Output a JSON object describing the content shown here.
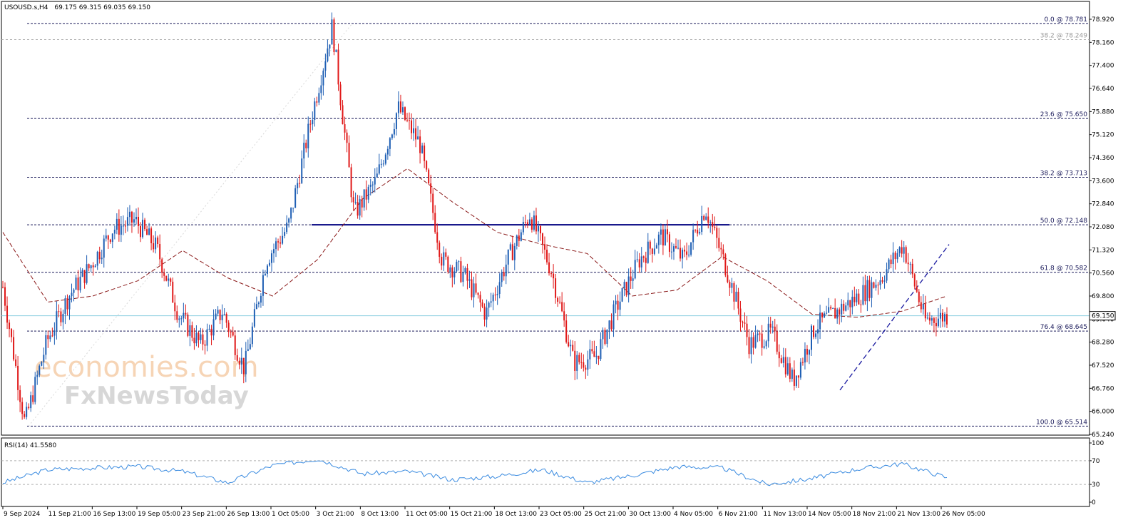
{
  "header": {
    "symbol": "USOUSD.s,H4",
    "ohlc": "69.175 69.315 69.035 69.150"
  },
  "watermark": {
    "line1": "economies.com",
    "line2": "FxNewsToday"
  },
  "rsi_panel": {
    "label": "RSI(14) 41.5580",
    "levels": [
      "100",
      "70",
      "30",
      "0"
    ]
  },
  "price_axis_ticks": [
    "78.920",
    "78.160",
    "77.400",
    "76.640",
    "75.880",
    "75.120",
    "74.360",
    "73.600",
    "72.840",
    "72.080",
    "71.320",
    "70.560",
    "69.800",
    "69.040",
    "68.280",
    "67.520",
    "66.760",
    "66.000",
    "65.240"
  ],
  "current_price": "69.150",
  "time_axis_labels": [
    "9 Sep 2024",
    "11 Sep 21:00",
    "16 Sep 13:00",
    "19 Sep 05:00",
    "23 Sep 21:00",
    "26 Sep 13:00",
    "1 Oct 05:00",
    "3 Oct 21:00",
    "8 Oct 13:00",
    "11 Oct 05:00",
    "15 Oct 21:00",
    "18 Oct 13:00",
    "23 Oct 05:00",
    "25 Oct 21:00",
    "30 Oct 13:00",
    "4 Nov 05:00",
    "6 Nov 21:00",
    "11 Nov 13:00",
    "14 Nov 05:00",
    "18 Nov 21:00",
    "21 Nov 13:00",
    "26 Nov 05:00"
  ],
  "fib_levels": [
    {
      "label": "0.0 @ 78.781",
      "value": 78.781
    },
    {
      "label": "38.2 @ 78.249",
      "value": 78.249
    },
    {
      "label": "23.6 @ 75.650",
      "value": 75.65
    },
    {
      "label": "38.2 @ 73.713",
      "value": 73.713
    },
    {
      "label": "50.0 @ 72.148",
      "value": 72.148
    },
    {
      "label": "61.8 @ 70.582",
      "value": 70.582
    },
    {
      "label": "76.4 @ 68.645",
      "value": 68.645
    },
    {
      "label": "100.0 @ 65.514",
      "value": 65.514
    }
  ],
  "colors": {
    "bull_candle": "#1f5fb4",
    "bear_candle": "#e01818",
    "fib_line": "#1a1a5a",
    "ma_line": "#8b1a1a",
    "rsi_line": "#3a8be0",
    "current_price_line": "#8ecfe0",
    "support_line": "#000080"
  },
  "chart_data": {
    "type": "candlestick",
    "y_axis_range": [
      65.24,
      78.92
    ],
    "rsi_range": [
      0,
      100
    ],
    "rsi_last": 41.558,
    "horizontal_support": 72.148,
    "price_path": [
      {
        "t": "9 Sep 2024",
        "price": 70.1
      },
      {
        "t": "10 Sep",
        "price": 65.6
      },
      {
        "t": "11 Sep 21:00",
        "price": 68.3
      },
      {
        "t": "14 Sep",
        "price": 69.8
      },
      {
        "t": "16 Sep 13:00",
        "price": 70.8
      },
      {
        "t": "19 Sep 05:00",
        "price": 72.0
      },
      {
        "t": "21 Sep",
        "price": 72.3
      },
      {
        "t": "23 Sep 21:00",
        "price": 71.4
      },
      {
        "t": "25 Sep",
        "price": 69.2
      },
      {
        "t": "26 Sep 13:00",
        "price": 68.2
      },
      {
        "t": "29 Sep",
        "price": 69.3
      },
      {
        "t": "30 Sep",
        "price": 67.4
      },
      {
        "t": "1 Oct 05:00",
        "price": 71.0
      },
      {
        "t": "2 Oct",
        "price": 72.1
      },
      {
        "t": "3 Oct 21:00",
        "price": 75.5
      },
      {
        "t": "7 Oct",
        "price": 78.7
      },
      {
        "t": "8 Oct 13:00",
        "price": 72.5
      },
      {
        "t": "9 Oct",
        "price": 73.6
      },
      {
        "t": "10 Oct",
        "price": 76.0
      },
      {
        "t": "11 Oct 05:00",
        "price": 74.8
      },
      {
        "t": "14 Oct",
        "price": 71.0
      },
      {
        "t": "15 Oct 21:00",
        "price": 70.5
      },
      {
        "t": "18 Oct 13:00",
        "price": 69.2
      },
      {
        "t": "21 Oct",
        "price": 71.0
      },
      {
        "t": "23 Oct 05:00",
        "price": 72.5
      },
      {
        "t": "24 Oct",
        "price": 70.6
      },
      {
        "t": "25 Oct 21:00",
        "price": 67.6
      },
      {
        "t": "28 Oct",
        "price": 67.8
      },
      {
        "t": "30 Oct 13:00",
        "price": 69.5
      },
      {
        "t": "1 Nov",
        "price": 71.0
      },
      {
        "t": "4 Nov 05:00",
        "price": 71.8
      },
      {
        "t": "5 Nov",
        "price": 71.0
      },
      {
        "t": "6 Nov 21:00",
        "price": 72.7
      },
      {
        "t": "8 Nov",
        "price": 70.6
      },
      {
        "t": "11 Nov 13:00",
        "price": 68.2
      },
      {
        "t": "13 Nov",
        "price": 68.6
      },
      {
        "t": "14 Nov 05:00",
        "price": 67.0
      },
      {
        "t": "15 Nov",
        "price": 68.8
      },
      {
        "t": "18 Nov 21:00",
        "price": 69.3
      },
      {
        "t": "20 Nov",
        "price": 69.8
      },
      {
        "t": "21 Nov 13:00",
        "price": 70.4
      },
      {
        "t": "22 Nov",
        "price": 71.5
      },
      {
        "t": "25 Nov",
        "price": 69.0
      },
      {
        "t": "26 Nov 05:00",
        "price": 69.15
      }
    ],
    "moving_average_path": [
      {
        "t": "9 Sep 2024",
        "price": 71.9
      },
      {
        "t": "11 Sep 21:00",
        "price": 69.6
      },
      {
        "t": "16 Sep 13:00",
        "price": 69.8
      },
      {
        "t": "19 Sep 05:00",
        "price": 70.3
      },
      {
        "t": "23 Sep 21:00",
        "price": 71.3
      },
      {
        "t": "26 Sep 13:00",
        "price": 70.4
      },
      {
        "t": "1 Oct 05:00",
        "price": 69.8
      },
      {
        "t": "3 Oct 21:00",
        "price": 71.0
      },
      {
        "t": "8 Oct 13:00",
        "price": 73.0
      },
      {
        "t": "11 Oct 05:00",
        "price": 74.0
      },
      {
        "t": "15 Oct 21:00",
        "price": 72.9
      },
      {
        "t": "18 Oct 13:00",
        "price": 71.9
      },
      {
        "t": "23 Oct 05:00",
        "price": 71.5
      },
      {
        "t": "25 Oct 21:00",
        "price": 71.2
      },
      {
        "t": "30 Oct 13:00",
        "price": 69.8
      },
      {
        "t": "4 Nov 05:00",
        "price": 70.0
      },
      {
        "t": "6 Nov 21:00",
        "price": 71.1
      },
      {
        "t": "11 Nov 13:00",
        "price": 70.3
      },
      {
        "t": "14 Nov 05:00",
        "price": 69.2
      },
      {
        "t": "18 Nov 21:00",
        "price": 69.1
      },
      {
        "t": "21 Nov 13:00",
        "price": 69.3
      },
      {
        "t": "26 Nov 05:00",
        "price": 69.8
      }
    ],
    "rsi_path": [
      {
        "t": "9 Sep 2024",
        "rsi": 33
      },
      {
        "t": "11 Sep 21:00",
        "rsi": 55
      },
      {
        "t": "16 Sep 13:00",
        "rsi": 58
      },
      {
        "t": "19 Sep 05:00",
        "rsi": 60
      },
      {
        "t": "23 Sep 21:00",
        "rsi": 52
      },
      {
        "t": "26 Sep 13:00",
        "rsi": 33
      },
      {
        "t": "1 Oct 05:00",
        "rsi": 62
      },
      {
        "t": "3 Oct 21:00",
        "rsi": 73
      },
      {
        "t": "8 Oct 13:00",
        "rsi": 48
      },
      {
        "t": "11 Oct 05:00",
        "rsi": 52
      },
      {
        "t": "15 Oct 21:00",
        "rsi": 38
      },
      {
        "t": "18 Oct 13:00",
        "rsi": 44
      },
      {
        "t": "23 Oct 05:00",
        "rsi": 55
      },
      {
        "t": "25 Oct 21:00",
        "rsi": 33
      },
      {
        "t": "30 Oct 13:00",
        "rsi": 45
      },
      {
        "t": "4 Nov 05:00",
        "rsi": 60
      },
      {
        "t": "6 Nov 21:00",
        "rsi": 58
      },
      {
        "t": "11 Nov 13:00",
        "rsi": 30
      },
      {
        "t": "14 Nov 05:00",
        "rsi": 40
      },
      {
        "t": "18 Nov 21:00",
        "rsi": 56
      },
      {
        "t": "21 Nov 13:00",
        "rsi": 65
      },
      {
        "t": "26 Nov 05:00",
        "rsi": 41.6
      }
    ]
  }
}
